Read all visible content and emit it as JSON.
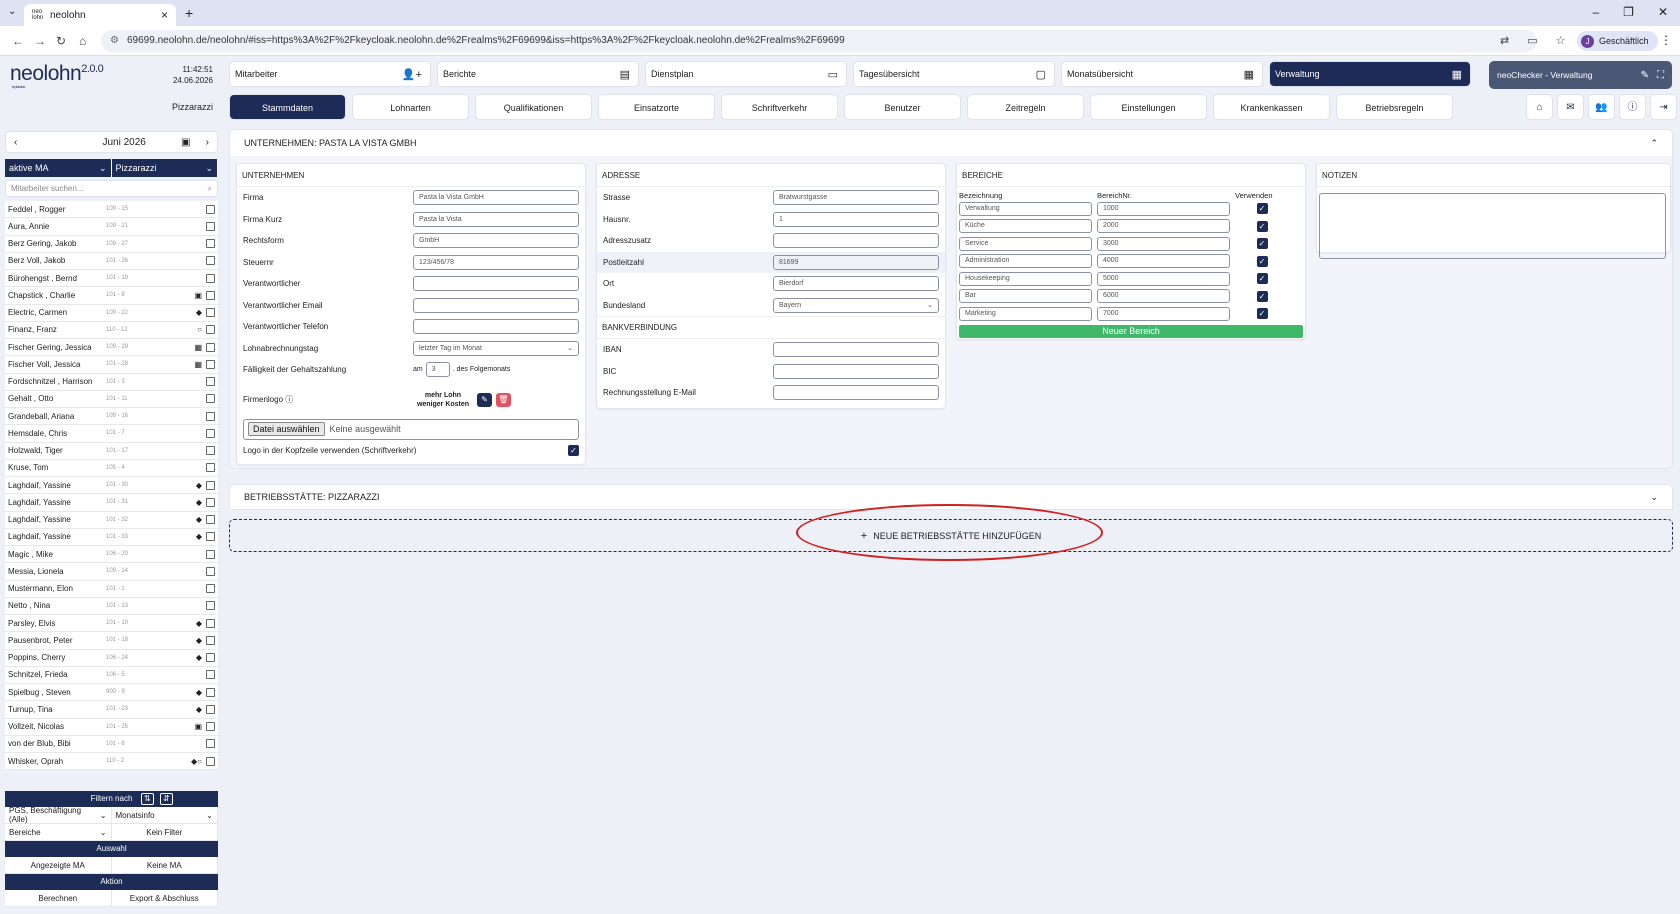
{
  "browser": {
    "tab_title": "neolohn",
    "fav_text": "neo lohn",
    "url": "69699.neolohn.de/neolohn/#iss=https%3A%2F%2Fkeycloak.neolohn.de%2Frealms%2F69699&iss=https%3A%2F%2Fkeycloak.neolohn.de%2Frealms%2F69699",
    "profile_initial": "J",
    "profile_label": "Geschäftlich"
  },
  "app": {
    "logo": "neolohn",
    "version": "2.0.0",
    "by": "by tvedoo",
    "time": "11:42:51",
    "date": "24.06.2026",
    "company": "Pizzarazzi"
  },
  "topnav": [
    {
      "label": "Mitarbeiter",
      "icon": "user-plus"
    },
    {
      "label": "Berichte",
      "icon": "report"
    },
    {
      "label": "Dienstplan",
      "icon": "card"
    },
    {
      "label": "Tagesübersicht",
      "icon": "calendar"
    },
    {
      "label": "Monatsübersicht",
      "icon": "calendar-grid"
    },
    {
      "label": "Verwaltung",
      "icon": "calculator"
    }
  ],
  "checker": {
    "label": "neoChecker - Verwaltung"
  },
  "subtabs": [
    "Stammdaten",
    "Lohnarten",
    "Qualifikationen",
    "Einsatzorte",
    "Schriftverkehr",
    "Benutzer",
    "Zeitregeln",
    "Einstellungen",
    "Krankenkassen",
    "Betriebsregeln"
  ],
  "sidebar": {
    "month": "Juni 2026",
    "filter_status": "aktive MA",
    "filter_company": "Pizzarazzi",
    "search_placeholder": "Mitarbeiter suchen...",
    "employees": [
      {
        "name": "Feddel , Rogger",
        "id": "109 - 15",
        "mark": ""
      },
      {
        "name": "Aura, Annie",
        "id": "109 - 21",
        "mark": ""
      },
      {
        "name": "Berz Gering, Jakob",
        "id": "109 - 27",
        "mark": ""
      },
      {
        "name": "Berz Voll, Jakob",
        "id": "101 - 26",
        "mark": ""
      },
      {
        "name": "Bürohengst , Bernd",
        "id": "101 - 19",
        "mark": ""
      },
      {
        "name": "Chapstick , Charlie",
        "id": "101 - 8",
        "mark": "▣"
      },
      {
        "name": "Electric, Carmen",
        "id": "109 - 22",
        "mark": "◆"
      },
      {
        "name": "Finanz, Franz",
        "id": "110 - 12",
        "mark": "○"
      },
      {
        "name": "Fischer Gering, Jessica",
        "id": "109 - 29",
        "mark": "▦"
      },
      {
        "name": "Fischer Voll, Jessica",
        "id": "101 - 28",
        "mark": "▦"
      },
      {
        "name": "Fordschnitzel , Harrison",
        "id": "101 - 3",
        "mark": ""
      },
      {
        "name": "Gehalt , Otto",
        "id": "101 - 11",
        "mark": ""
      },
      {
        "name": "Grandeball, Ariana",
        "id": "109 - 16",
        "mark": ""
      },
      {
        "name": "Hemsdale, Chris",
        "id": "101 - 7",
        "mark": ""
      },
      {
        "name": "Holzwald, Tiger",
        "id": "101 - 17",
        "mark": ""
      },
      {
        "name": "Kruse, Tom",
        "id": "105 - 4",
        "mark": ""
      },
      {
        "name": "Laghdaif, Yassine",
        "id": "101 - 30",
        "mark": "◆"
      },
      {
        "name": "Laghdaif, Yassine",
        "id": "101 - 31",
        "mark": "◆"
      },
      {
        "name": "Laghdaif, Yassine",
        "id": "101 - 32",
        "mark": "◆"
      },
      {
        "name": "Laghdaif, Yassine",
        "id": "101 - 33",
        "mark": "◆"
      },
      {
        "name": "Magic , Mike",
        "id": "106 - 20",
        "mark": ""
      },
      {
        "name": "Messia, Lionela",
        "id": "109 - 14",
        "mark": ""
      },
      {
        "name": "Mustermann, Elon",
        "id": "101 - 1",
        "mark": ""
      },
      {
        "name": "Netto , Nina",
        "id": "101 - 13",
        "mark": ""
      },
      {
        "name": "Parsley, Elvis",
        "id": "101 - 10",
        "mark": "◆"
      },
      {
        "name": "Pausenbrot, Peter",
        "id": "101 - 18",
        "mark": "◆"
      },
      {
        "name": "Poppins, Cherry",
        "id": "106 - 24",
        "mark": "◆"
      },
      {
        "name": "Schnitzel, Frieda",
        "id": "106 - 5",
        "mark": ""
      },
      {
        "name": "Spielbug , Steven",
        "id": "900 - 9",
        "mark": "◆"
      },
      {
        "name": "Turnup, Tina",
        "id": "101 - 23",
        "mark": "◆"
      },
      {
        "name": "Vollzeit, Nicolas",
        "id": "101 - 25",
        "mark": "▣"
      },
      {
        "name": "von der Blub, Bibi",
        "id": "101 - 6",
        "mark": ""
      },
      {
        "name": "Whisker, Oprah",
        "id": "110 - 2",
        "mark": "◆○"
      }
    ],
    "filter_title": "Filtern nach",
    "filter_sel1": "PGS, Beschäftigung (Alle)",
    "filter_sel2": "Monatsinfo",
    "filter_sel3": "Bereiche",
    "filter_none": "Kein Filter",
    "auswahl_title": "Auswahl",
    "auswahl_shown": "Angezeigte MA",
    "auswahl_none": "Keine MA",
    "aktion_title": "Aktion",
    "aktion_calc": "Berechnen",
    "aktion_export": "Export & Abschluss"
  },
  "company_card": {
    "title": "UNTERNEHMEN: PASTA LA VISTA GMBH",
    "unternehmen": {
      "heading": "UNTERNEHMEN",
      "fields": [
        {
          "label": "Firma",
          "value": "Pasta la Vista GmbH"
        },
        {
          "label": "Firma Kurz",
          "value": "Pasta la Vista"
        },
        {
          "label": "Rechtsform",
          "value": "GmbH"
        },
        {
          "label": "Steuernr",
          "value": "123/456/78"
        },
        {
          "label": "Verantwortlicher",
          "value": ""
        },
        {
          "label": "Verantwortlicher Email",
          "value": ""
        },
        {
          "label": "Verantwortlicher Telefon",
          "value": ""
        },
        {
          "label": "Lohnabrechnungstag",
          "value": "letzter Tag im Monat"
        }
      ],
      "faelligkeit_label": "Fälligkeit der Gehaltszahlung",
      "faelligkeit_pre": "am",
      "faelligkeit_value": "3",
      "faelligkeit_post": ". des Folgemonats",
      "logo_label": "Firmenlogo",
      "logo_text1": "mehr Lohn",
      "logo_text2": "weniger Kosten",
      "file_button": "Datei auswählen",
      "file_none": "Keine ausgewählt",
      "logo_header_label": "Logo in der Kopfzeile verwenden (Schriftverkehr)"
    },
    "adresse": {
      "heading": "ADRESSE",
      "fields": [
        {
          "label": "Strasse",
          "value": "Bratwurstgasse"
        },
        {
          "label": "Hausnr.",
          "value": "1"
        },
        {
          "label": "Adresszusatz",
          "value": ""
        },
        {
          "label": "Postleitzahl",
          "value": "81699"
        },
        {
          "label": "Ort",
          "value": "Bierdorf"
        },
        {
          "label": "Bundesland",
          "value": "Bayern"
        }
      ],
      "bank_heading": "BANKVERBINDUNG",
      "bank_fields": [
        {
          "label": "IBAN",
          "value": ""
        },
        {
          "label": "BIC",
          "value": ""
        },
        {
          "label": "Rechnungsstellung E-Mail",
          "value": ""
        }
      ]
    },
    "bereiche": {
      "heading": "BEREICHE",
      "col1": "Bezeichnung",
      "col2": "BereichNr.",
      "col3": "Verwenden",
      "rows": [
        {
          "name": "Verwaltung",
          "nr": "1000"
        },
        {
          "name": "Küche",
          "nr": "2000"
        },
        {
          "name": "Service",
          "nr": "3000"
        },
        {
          "name": "Administration",
          "nr": "4000"
        },
        {
          "name": "Housekeeping",
          "nr": "5000"
        },
        {
          "name": "Bar",
          "nr": "6000"
        },
        {
          "name": "Marketing",
          "nr": "7000"
        }
      ],
      "new_button": "Neuer Bereich"
    },
    "notizen": {
      "heading": "NOTIZEN"
    }
  },
  "betrieb_card": {
    "title": "BETRIEBSSTÄTTE: PIZZARAZZI"
  },
  "add_button": {
    "label": "NEUE BETRIEBSSTÄTTE HINZUFÜGEN"
  },
  "colors": {
    "primary": "#1d2b57",
    "success": "#3fb86a",
    "danger": "#e05461",
    "annotation": "#d02020"
  }
}
